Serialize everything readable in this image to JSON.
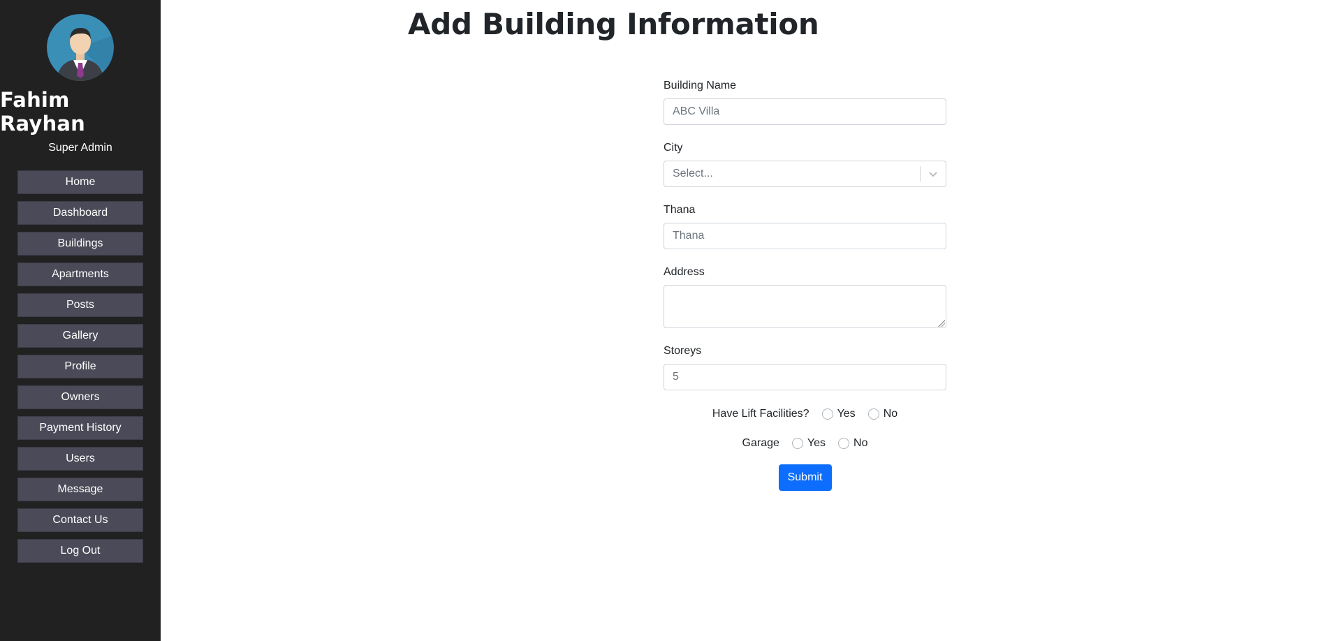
{
  "sidebar": {
    "user_name": "Fahim Rayhan",
    "user_role": "Super Admin",
    "items": [
      {
        "label": "Home"
      },
      {
        "label": "Dashboard"
      },
      {
        "label": "Buildings"
      },
      {
        "label": "Apartments"
      },
      {
        "label": "Posts"
      },
      {
        "label": "Gallery"
      },
      {
        "label": "Profile"
      },
      {
        "label": "Owners"
      },
      {
        "label": "Payment History"
      },
      {
        "label": "Users"
      },
      {
        "label": "Message"
      },
      {
        "label": "Contact Us"
      },
      {
        "label": "Log Out"
      }
    ]
  },
  "main": {
    "title": "Add Building Information",
    "form": {
      "building_name_label": "Building Name",
      "building_name_placeholder": "ABC Villa",
      "city_label": "City",
      "city_placeholder": "Select...",
      "thana_label": "Thana",
      "thana_placeholder": "Thana",
      "address_label": "Address",
      "address_value": "",
      "storeys_label": "Storeys",
      "storeys_placeholder": "5",
      "lift_question": "Have Lift Facilities?",
      "lift_yes": "Yes",
      "lift_no": "No",
      "garage_question": "Garage",
      "garage_yes": "Yes",
      "garage_no": "No",
      "submit_label": "Submit"
    }
  },
  "colors": {
    "sidebar_bg": "#212121",
    "nav_button_bg": "#4a4a58",
    "submit_bg": "#0d6efd"
  }
}
